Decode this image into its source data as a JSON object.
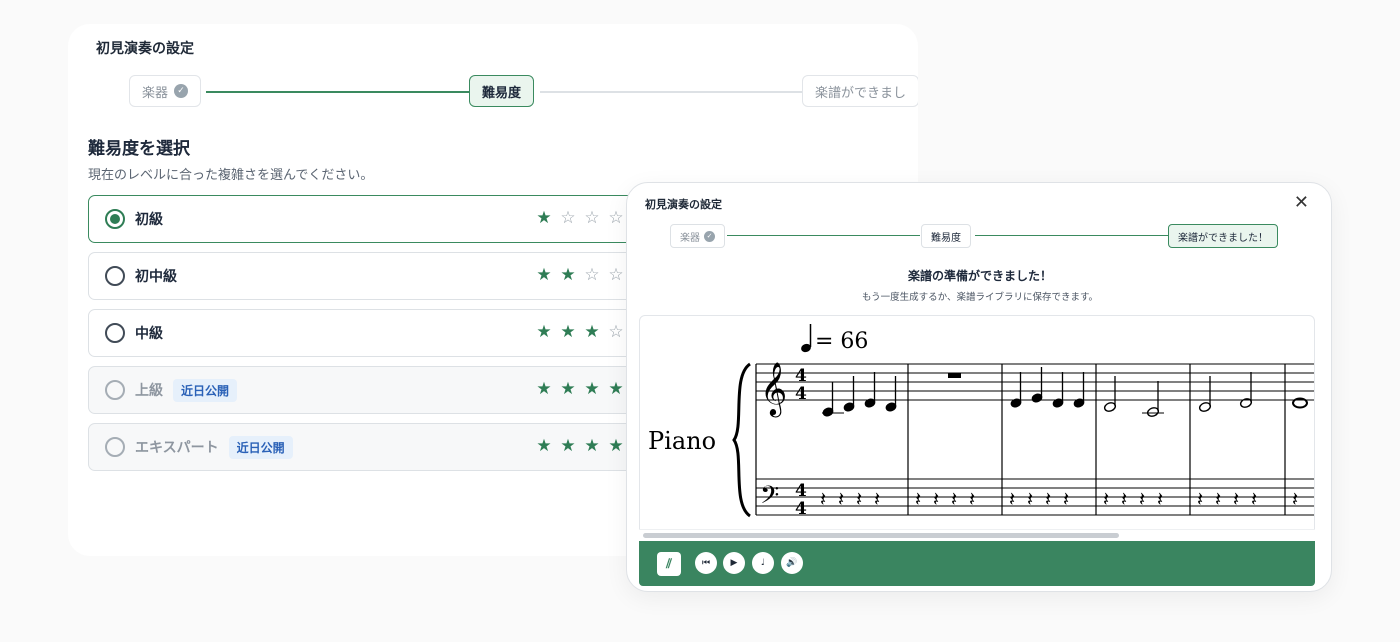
{
  "back": {
    "title": "初見演奏の設定",
    "steps": [
      {
        "label": "楽器"
      },
      {
        "label": "難易度"
      },
      {
        "label": "楽譜ができまし"
      }
    ],
    "heading": "難易度を選択",
    "subheading": "現在のレベルに合った複雑さを選んでください。",
    "options": [
      {
        "label": "初級",
        "badge": "",
        "stars": 1
      },
      {
        "label": "初中級",
        "badge": "",
        "stars": 2
      },
      {
        "label": "中級",
        "badge": "",
        "stars": 3
      },
      {
        "label": "上級",
        "badge": "近日公開",
        "stars": 4
      },
      {
        "label": "エキスパート",
        "badge": "近日公開",
        "stars": 4
      }
    ]
  },
  "card": {
    "title": "初見演奏の設定",
    "steps": [
      {
        "label": "楽器"
      },
      {
        "label": "難易度"
      },
      {
        "label": "楽譜ができました！"
      }
    ],
    "heading": "楽譜の準備ができました！",
    "subheading": "もう一度生成するか、楽譜ライブラリに保存できます。",
    "score": {
      "tempo": "= 66",
      "instrument": "Piano",
      "time_signature_top": "4",
      "time_signature_bottom": "4"
    }
  },
  "icons": {
    "check": "check-circle-icon",
    "close": "close-icon",
    "star_filled": "star-filled-icon",
    "star_empty": "star-empty-icon",
    "logo": "app-logo-icon",
    "skip_back": "skip-back-icon",
    "play": "play-icon",
    "metronome": "metronome-icon",
    "volume": "volume-icon"
  },
  "colors": {
    "accent": "#3a8a5f",
    "player_bar": "#3a8560",
    "badge_text": "#2a61b7",
    "badge_bg": "#e6f0fb"
  }
}
